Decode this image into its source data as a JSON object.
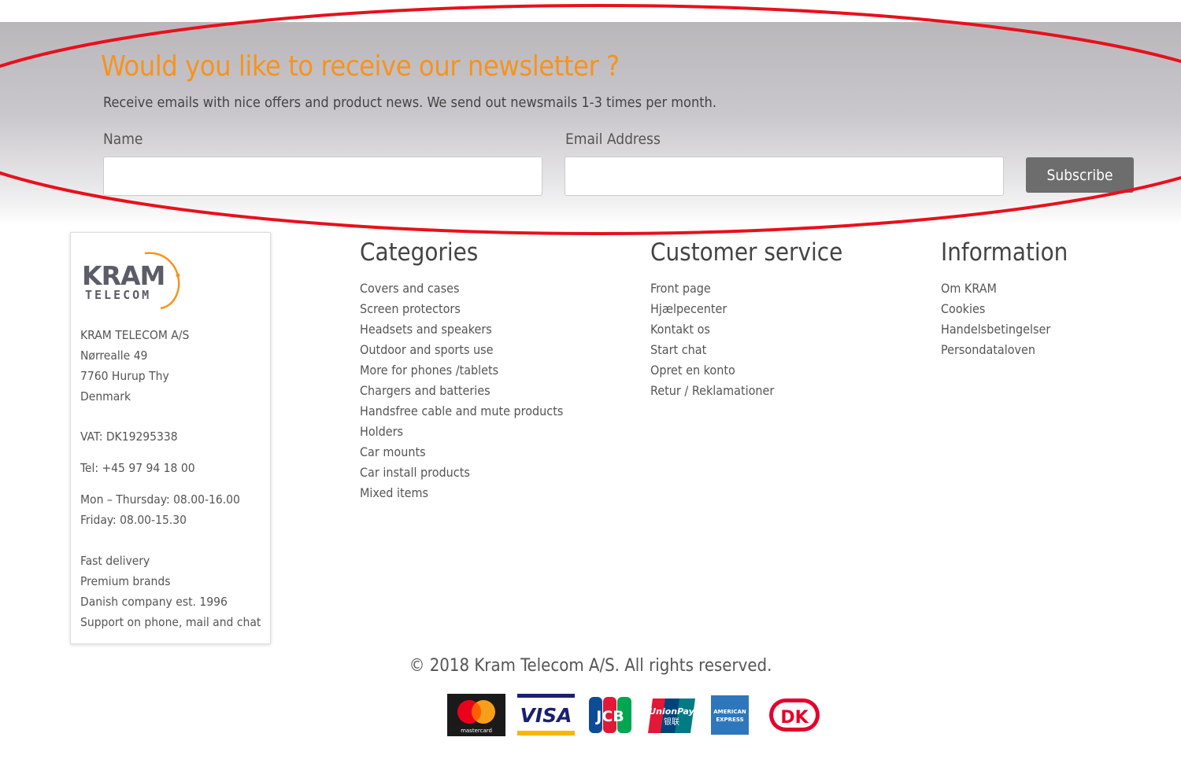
{
  "newsletter": {
    "title": "Would you like to receive our newsletter ?",
    "subtitle": "Receive emails with nice offers and product news. We send out newsmails 1-3 times per month.",
    "name_label": "Name",
    "email_label": "Email Address",
    "name_value": "",
    "email_value": "",
    "subscribe_label": "Subscribe"
  },
  "company": {
    "logo_text": "KRAM",
    "logo_subtext": "TELECOM",
    "lines": [
      "KRAM TELECOM A/S",
      "Nørrealle 49",
      "7760 Hurup Thy",
      "Denmark"
    ],
    "vat": "VAT: DK19295338",
    "tel": "Tel: +45 97 94 18 00",
    "hours": [
      "Mon – Thursday: 08.00-16.00",
      "Friday: 08.00-15.30"
    ],
    "features": [
      "Fast delivery",
      "Premium brands",
      "Danish company est. 1996",
      "Support on phone, mail and chat"
    ]
  },
  "categories": {
    "heading": "Categories",
    "items": [
      "Covers and cases",
      "Screen protectors",
      "Headsets and speakers",
      "Outdoor and sports use",
      "More for phones /tablets",
      "Chargers and batteries",
      "Handsfree cable and mute products",
      "Holders",
      "Car mounts",
      "Car install products",
      "Mixed items"
    ]
  },
  "customer_service": {
    "heading": "Customer service",
    "items": [
      "Front page",
      "Hjælpecenter",
      "Kontakt os",
      "Start chat",
      "Opret en konto",
      "Retur / Reklamationer"
    ]
  },
  "information": {
    "heading": "Information",
    "items": [
      "Om KRAM",
      "Cookies",
      "Handelsbetingelser",
      "Persondataloven"
    ]
  },
  "footer": {
    "copyright": "© 2018 Kram Telecom A/S. All rights reserved.",
    "payment_logos": {
      "mastercard": "mastercard",
      "visa": "VISA",
      "jcb": "JCB",
      "unionpay": "UnionPay",
      "unionpay_cn": "银联",
      "amex_line1": "AMERICAN",
      "amex_line2": "EXPRESS",
      "dankort": "DK"
    }
  },
  "colors": {
    "accent": "#f7931e",
    "annotation": "#e8101c",
    "button": "#6d6d6d"
  }
}
